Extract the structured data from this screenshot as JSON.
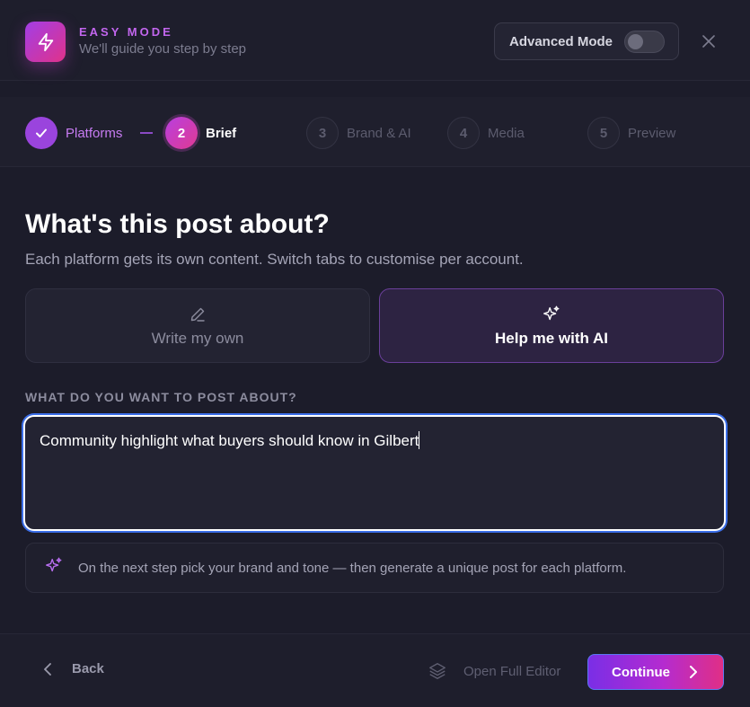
{
  "header": {
    "mode_title": "EASY MODE",
    "mode_subtitle": "We'll guide you step by step",
    "advanced_mode_label": "Advanced Mode",
    "advanced_mode_on": false,
    "logo_icon": "lightning-bolt-icon",
    "close_icon": "close-icon"
  },
  "stepper": {
    "steps": [
      {
        "number": "✓",
        "label": "Platforms",
        "state": "done"
      },
      {
        "number": "2",
        "label": "Brief",
        "state": "active"
      },
      {
        "number": "3",
        "label": "Brand & AI",
        "state": "todo"
      },
      {
        "number": "4",
        "label": "Media",
        "state": "todo"
      },
      {
        "number": "5",
        "label": "Preview",
        "state": "todo"
      }
    ]
  },
  "main": {
    "title": "What's this post about?",
    "subtitle": "Each platform gets its own content. Switch tabs to customise per account.",
    "choices": [
      {
        "label": "Write my own",
        "icon": "pencil-icon",
        "selected": false
      },
      {
        "label": "Help me with AI",
        "icon": "sparkles-icon",
        "selected": true
      }
    ],
    "field_label": "WHAT DO YOU WANT TO POST ABOUT?",
    "field_value": "Community highlight what buyers should know in Gilbert",
    "hint": "On the next step pick your brand and tone — then generate a unique post for each platform."
  },
  "footer": {
    "back_label": "Back",
    "open_editor_label": "Open Full Editor",
    "continue_label": "Continue"
  },
  "colors": {
    "accent_purple": "#9a44dd",
    "accent_pink": "#e0328a",
    "background": "#1c1c2a",
    "focus_blue": "#3b6ee8"
  }
}
